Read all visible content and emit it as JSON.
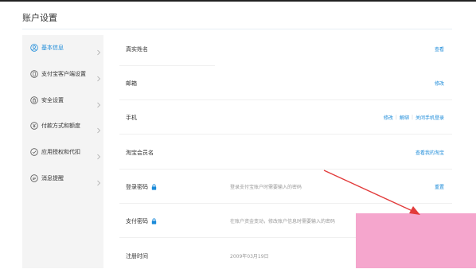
{
  "page": {
    "title": "账户设置"
  },
  "sidebar": {
    "items": [
      {
        "label": "基本信息",
        "icon": "user-circle-icon",
        "active": true
      },
      {
        "label": "支付宝客户端设置",
        "icon": "mobile-icon"
      },
      {
        "label": "安全设置",
        "icon": "lock-icon"
      },
      {
        "label": "付款方式和额度",
        "icon": "yen-icon"
      },
      {
        "label": "应用授权和代扣",
        "icon": "check-circle-icon"
      },
      {
        "label": "消息提醒",
        "icon": "message-icon"
      }
    ]
  },
  "rows": [
    {
      "label": "真实姓名",
      "action": "查看"
    },
    {
      "label": "邮箱",
      "action": "修改"
    },
    {
      "label": "手机",
      "actions": [
        "修改",
        "解绑",
        "关闭手机登录"
      ]
    },
    {
      "label": "淘宝会员名",
      "action": "查看我的淘宝"
    },
    {
      "label": "登录密码",
      "desc": "登录支付宝账户时需要输入的密码",
      "action": "重置"
    },
    {
      "label": "支付密码",
      "desc": "在账户资金变动，修改账户信息时需要输入的密码"
    },
    {
      "label": "注册时间",
      "desc": "2009年03月19日"
    }
  ],
  "colors": {
    "link": "#1a8ad9",
    "annotation_arrow": "#e23b3b",
    "highlight_block": "#f5a6cd"
  }
}
